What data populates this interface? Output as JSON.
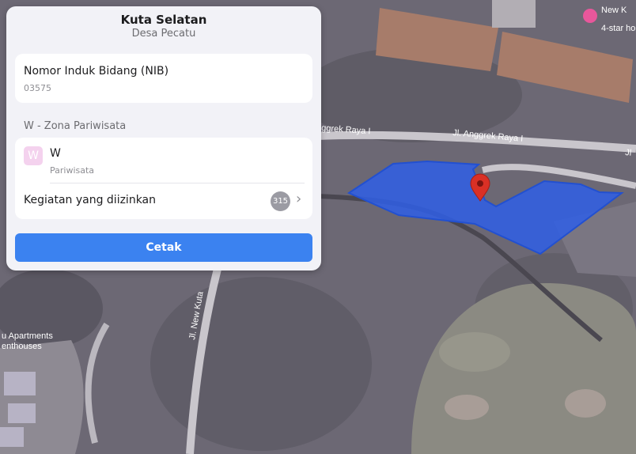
{
  "panel": {
    "title": "Kuta Selatan",
    "subtitle": "Desa Pecatu",
    "nib": {
      "label": "Nomor Induk Bidang (NIB)",
      "value": "03575"
    },
    "zone_section_label": "W - Zona Pariwisata",
    "zone": {
      "badge_letter": "W",
      "badge_color": "#f4d2ee",
      "code": "W",
      "description": "Pariwisata",
      "activities_label": "Kegiatan yang diizinkan",
      "activities_count": "315"
    },
    "print_button_label": "Cetak",
    "accent_color": "#3b82f0"
  },
  "map": {
    "road_labels": [
      "ggrek Raya I",
      "Jl. Anggrek Raya I",
      "Jl. New Kuta",
      "Jl"
    ],
    "place_labels": [
      "u Apartments",
      "enthouses",
      "New K",
      "4-star ho"
    ],
    "parcel_color": "#2f5fe6",
    "marker_icon": "map-pin-icon",
    "marker_color": "#d93025"
  }
}
